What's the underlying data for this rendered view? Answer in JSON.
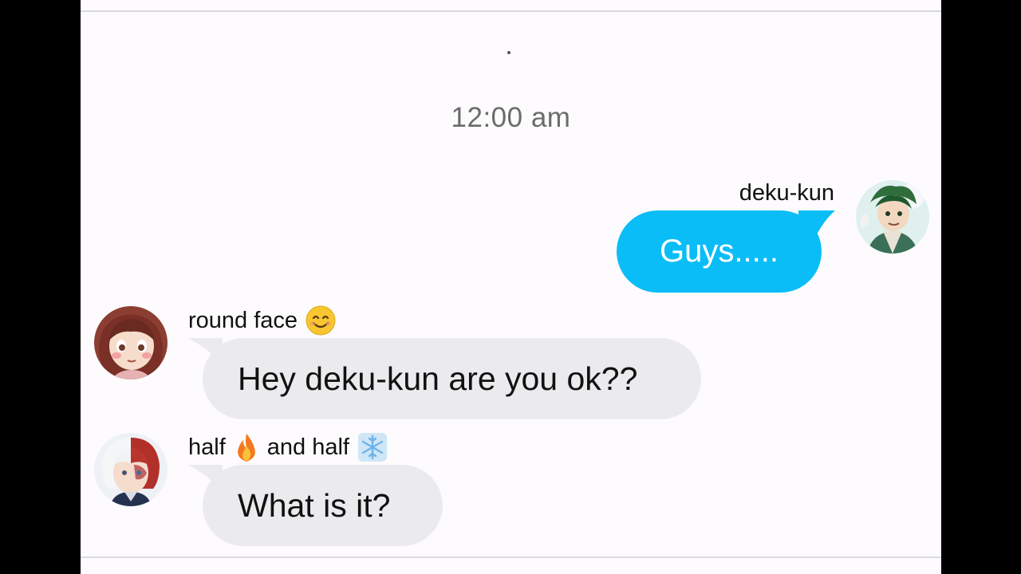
{
  "header": {
    "indicator_dot": "."
  },
  "timestamp": "12:00 am",
  "messages": [
    {
      "sender": "deku-kun",
      "sender_emoji": "",
      "text": "Guys.....",
      "direction": "outgoing",
      "bubble_color": "#0bbdf7",
      "avatar_icon": "deku-avatar-icon"
    },
    {
      "sender": "round face",
      "sender_emoji": "smiling-face-icon",
      "text": "Hey deku-kun are you ok??",
      "direction": "incoming",
      "bubble_color": "#ebebee",
      "avatar_icon": "uraraka-avatar-icon"
    },
    {
      "sender_parts": [
        "half",
        "and half"
      ],
      "sender_emojis": [
        "fire-icon",
        "snowflake-icon"
      ],
      "text": "What is it?",
      "direction": "incoming",
      "bubble_color": "#ebebee",
      "avatar_icon": "todoroki-avatar-icon"
    }
  ],
  "colors": {
    "accent": "#0bbdf7",
    "incoming_bubble": "#ebebee",
    "background": "#fdfbfd"
  }
}
